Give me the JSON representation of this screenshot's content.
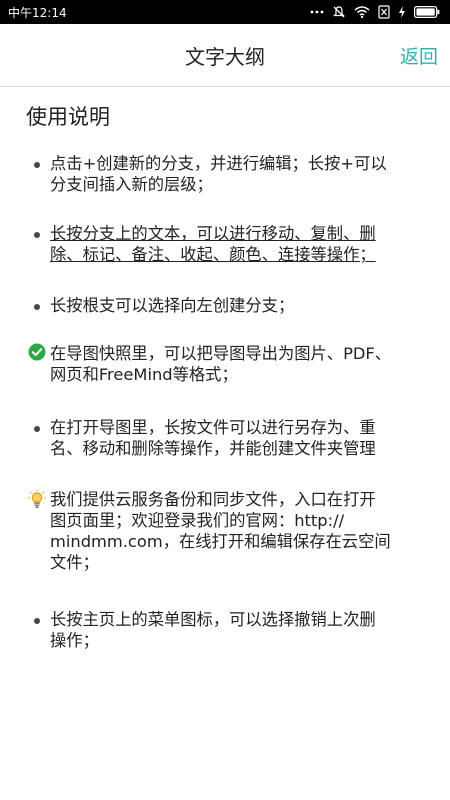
{
  "status_bar": {
    "time": "中午12:14",
    "icons": [
      "signal-dots-icon",
      "mute-icon",
      "wifi-icon",
      "sim-icon",
      "charging-icon",
      "battery-icon"
    ]
  },
  "header": {
    "title": "文字大纲",
    "back_label": "返回"
  },
  "section": {
    "title": "使用说明"
  },
  "items": [
    {
      "marker": "bullet",
      "lines": [
        "点击+创建新的分支，并进行编辑；长按+可以",
        "分支间插入新的层级；"
      ]
    },
    {
      "marker": "bullet",
      "underline": true,
      "lines": [
        "长按分支上的文本，可以进行移动、复制、删",
        "除、标记、备注、收起、颜色、连接等操作；"
      ]
    },
    {
      "marker": "bullet",
      "lines": [
        "长按根支可以选择向左创建分支；"
      ]
    },
    {
      "marker": "check-circle-icon",
      "lines": [
        "在导图快照里，可以把导图导出为图片、PDF、",
        "网页和FreeMind等格式；"
      ]
    },
    {
      "marker": "bullet",
      "lines": [
        "在打开导图里，长按文件可以进行另存为、重",
        "名、移动和删除等操作，并能创建文件夹管理"
      ]
    },
    {
      "marker": "lightbulb-icon",
      "lines": [
        "我们提供云服务备份和同步文件，入口在打开",
        "图页面里；欢迎登录我们的官网：http://",
        "mindmm.com，在线打开和编辑保存在云空间",
        "文件；"
      ]
    },
    {
      "marker": "bullet",
      "lines": [
        "长按主页上的菜单图标，可以选择撤销上次删",
        "操作；"
      ]
    }
  ],
  "colors": {
    "accent": "#2bb5a9",
    "check": "#2ca84a",
    "bulb": "#e8b730"
  }
}
